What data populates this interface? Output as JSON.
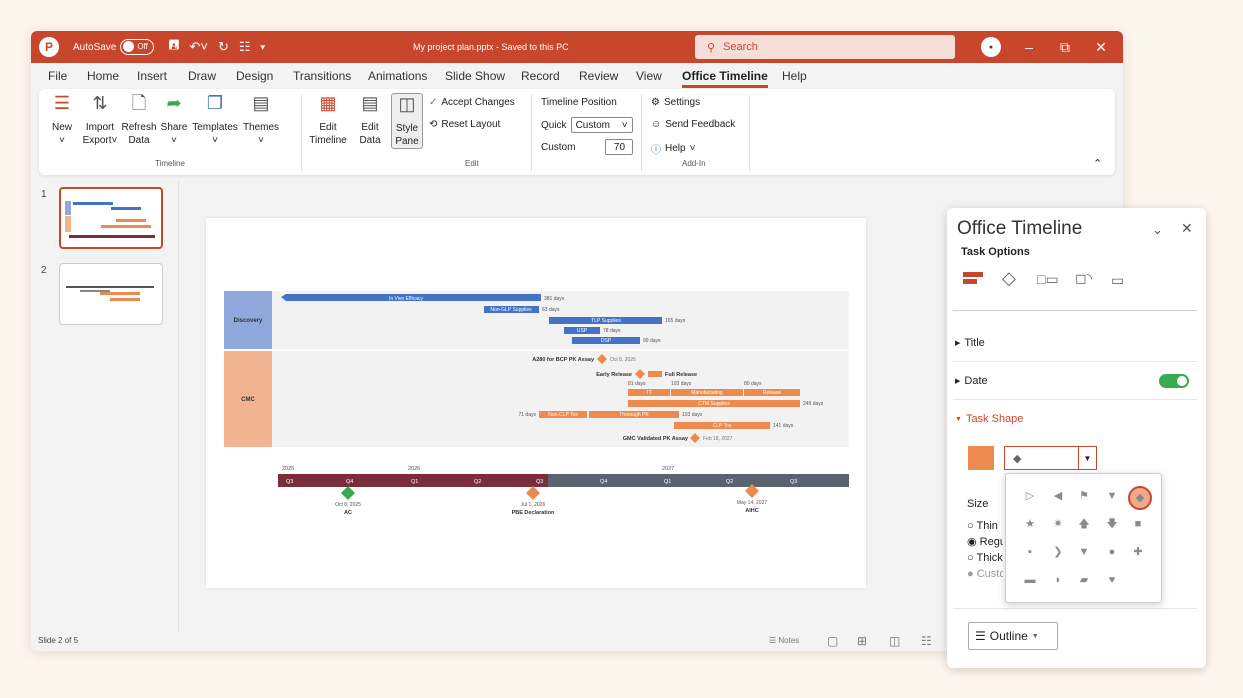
{
  "titlebar": {
    "app_letter": "P",
    "autosave": "AutoSave",
    "toggle": "Off",
    "doc_title": "My project plan.pptx - Saved to this PC",
    "search": "Search"
  },
  "tabs": [
    "File",
    "Home",
    "Insert",
    "Draw",
    "Design",
    "Transitions",
    "Animations",
    "Slide Show",
    "Record",
    "Review",
    "View",
    "Office Timeline",
    "Help"
  ],
  "ribbon": {
    "timeline_group": "Timeline",
    "edit_group": "Edit",
    "addin_group": "Add-In",
    "new": "New",
    "import_export_1": "Import",
    "import_export_2": "Export",
    "refresh_1": "Refresh",
    "refresh_2": "Data",
    "share": "Share",
    "templates": "Templates",
    "themes": "Themes",
    "edit_timeline_1": "Edit",
    "edit_timeline_2": "Timeline",
    "edit_data_1": "Edit",
    "edit_data_2": "Data",
    "style_pane_1": "Style",
    "style_pane_2": "Pane",
    "accept_changes": "Accept Changes",
    "reset_layout": "Reset Layout",
    "timeline_position": "Timeline Position",
    "quick": "Quick",
    "quick_value": "Custom",
    "custom": "Custom",
    "custom_value": "70",
    "settings": "Settings",
    "send_feedback": "Send Feedback",
    "help": "Help"
  },
  "thumbs": {
    "n1": "1",
    "n2": "2"
  },
  "slide": {
    "lane1": "Discovery",
    "lane2": "CMC",
    "bars": {
      "in_vivo": "In Vivo Efficacy",
      "in_vivo_d": "381 days",
      "non_glp": "Non-GLP Supplies",
      "non_glp_d": "63 days",
      "tlp": "TLP Supplies",
      "tlp_d": "165 days",
      "usp": "USP",
      "usp_d": "78 days",
      "dsp": "DSP",
      "dsp_d": "99 days",
      "a280": "A280 for BCP PK Assay",
      "a280_date": "Oct 8, 2026",
      "early": "Early Release",
      "full": "Full Release",
      "d81": "81 days",
      "d103": "103 days",
      "d80": "80 days",
      "tt": "TT",
      "manufacturing": "Manufacturing",
      "release": "Release",
      "ctm": "CTM Supplies",
      "ctm_d": "249 days",
      "d71": "71 days",
      "non_clp": "Non-CLP Tox",
      "thorough": "Thorough PK",
      "d103b": "103 days",
      "clp": "CLP Tox",
      "clp_d": "141 days",
      "gmc": "GMC Validated PK Assay",
      "gmc_date": "Feb 18, 2027"
    },
    "years": [
      "2025",
      "2026",
      "2027"
    ],
    "quarters": [
      "Q3",
      "Q4",
      "Q1",
      "Q2",
      "Q3",
      "Q4",
      "Q1",
      "Q2",
      "Q3"
    ],
    "milestones": [
      {
        "date": "Oct 8, 2025",
        "name": "AC"
      },
      {
        "date": "Jul 1, 2026",
        "name": "PBE Declaration"
      },
      {
        "date": "May 14, 2027",
        "name": "AIHC"
      }
    ]
  },
  "status": {
    "slide": "Slide 2 of 5",
    "notes": "Notes"
  },
  "panel": {
    "title": "Office Timeline",
    "sub": "Task Options",
    "sec_title": "Title",
    "sec_date": "Date",
    "sec_shape": "Task Shape",
    "size": "Size",
    "opt1": "Thin",
    "opt2": "Regular",
    "opt3": "Thick",
    "opt4": "Custom",
    "outline": "Outline"
  },
  "colors": {
    "accent": "#c8472c",
    "blue": "#4472c4",
    "orange": "#ed8a4d",
    "green": "#3aaa4e"
  }
}
